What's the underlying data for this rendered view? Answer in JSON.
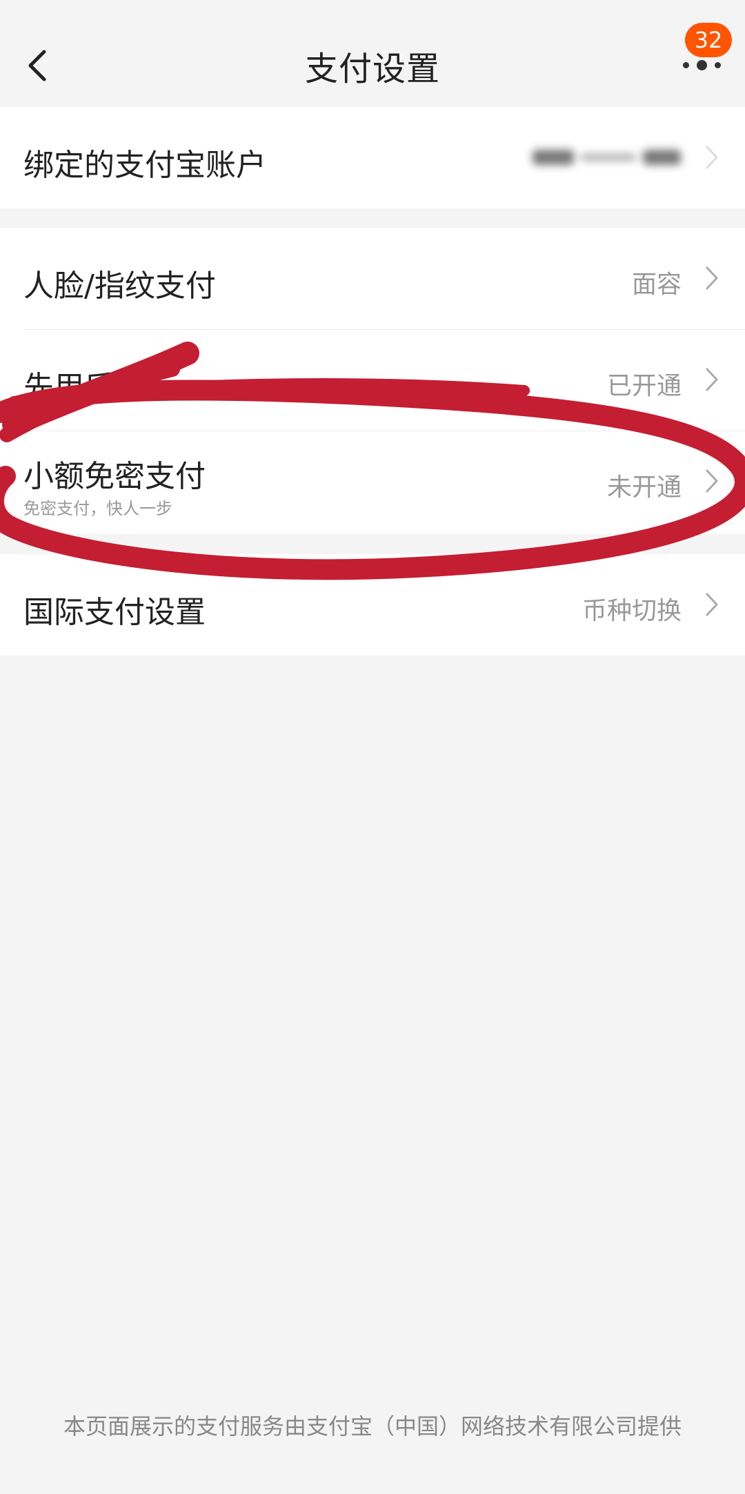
{
  "header": {
    "title": "支付设置",
    "back_icon": "chevron-left-icon",
    "more_icon": "more-dots-icon",
    "badge_count": "32",
    "badge_color": "#ff5500"
  },
  "account": {
    "label": "绑定的支付宝账户"
  },
  "settings": {
    "face_pay": {
      "label": "人脸/指纹支付",
      "value": "面容"
    },
    "pay_later": {
      "label": "先用后付",
      "value": "已开通"
    },
    "small_pay": {
      "label": "小额免密支付",
      "sublabel": "免密支付，快人一步",
      "value": "未开通"
    }
  },
  "international": {
    "label": "国际支付设置",
    "value": "币种切换"
  },
  "footer": {
    "text": "本页面展示的支付服务由支付宝（中国）网络技术有限公司提供"
  },
  "annotation": {
    "color": "#c41e33"
  }
}
